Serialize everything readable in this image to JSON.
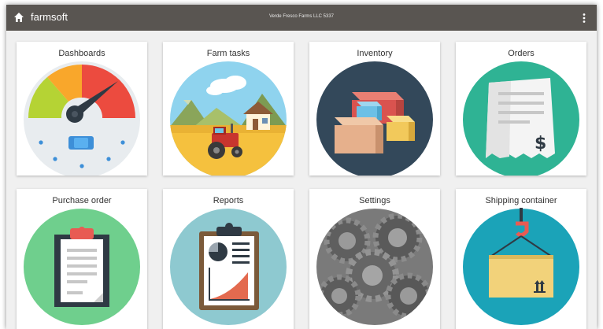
{
  "header": {
    "app_name": "farmsoft",
    "organization": "Verde Fresco Farms LLC 5337",
    "home_icon": "home-icon",
    "menu_icon": "more-vertical-icon",
    "bar_color": "#595551"
  },
  "tiles": [
    {
      "label": "Dashboards",
      "icon": "dashboard-gauge-icon"
    },
    {
      "label": "Farm tasks",
      "icon": "farm-tractor-icon"
    },
    {
      "label": "Inventory",
      "icon": "inventory-boxes-icon"
    },
    {
      "label": "Orders",
      "icon": "orders-receipt-icon"
    },
    {
      "label": "Purchase order",
      "icon": "purchase-order-clipboard-icon"
    },
    {
      "label": "Reports",
      "icon": "reports-clipboard-chart-icon"
    },
    {
      "label": "Settings",
      "icon": "settings-gears-icon"
    },
    {
      "label": "Shipping container",
      "icon": "shipping-container-icon"
    }
  ],
  "receipt_symbol": "$"
}
